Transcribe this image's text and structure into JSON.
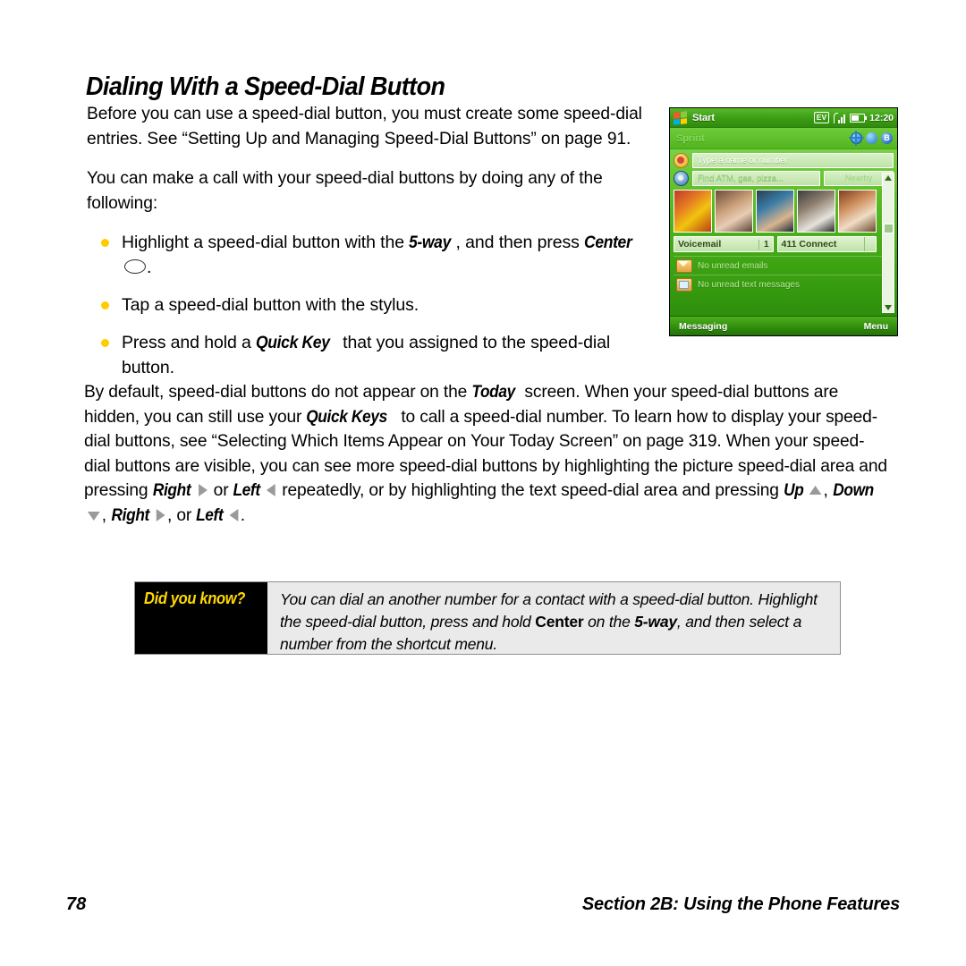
{
  "document": {
    "heading": "Dialing With a Speed-Dial Button",
    "paragraphs": {
      "intro1": "Before you can use a speed-dial button, you must create some speed-dial entries. See “Setting Up and Managing Speed-Dial Buttons” on page 91.",
      "intro2": "You can make a call with your speed-dial buttons by doing any of the following:"
    },
    "bullets": [
      {
        "pre": "Highlight a speed-dial button with the ",
        "em1": "5-way",
        "mid": ", and then press ",
        "em2": "Center",
        "glyph": "center-oval",
        "post": "."
      },
      {
        "pre": "Tap a speed-dial button with the stylus.",
        "em1": "",
        "mid": "",
        "em2": "",
        "glyph": "",
        "post": ""
      },
      {
        "pre": "Press and hold a ",
        "em1": "Quick Key",
        "mid": " that you assigned to the speed-dial button.",
        "em2": "",
        "glyph": "",
        "post": ""
      }
    ],
    "body_paragraph": {
      "s1": "By default, speed-dial buttons do not appear on the ",
      "em_today": "Today",
      "s2": " screen. When your speed-dial buttons are hidden, you can still use your ",
      "em_quickkeys": "Quick Keys",
      "s3": " to call a speed-dial number. To learn how to display your speed-dial buttons, see “Selecting Which Items Appear on Your Today Screen” on page 319. When your speed-dial buttons are visible, you can see more speed-dial buttons by highlighting the picture speed-dial area and pressing ",
      "em_right1": "Right",
      "s4": " or ",
      "em_left1": "Left",
      "s5": " repeatedly, or by highlighting the text speed-dial area and pressing ",
      "em_up": "Up",
      "s6": ", ",
      "em_down": "Down",
      "s7": ", ",
      "em_right2": "Right",
      "s8": ", or ",
      "em_left2": "Left",
      "s9": "."
    },
    "callout": {
      "label": "Did you know?",
      "line1": "You can dial an another number for a contact with a speed-dial button.",
      "line2_a": "Highlight the speed-dial button, press and hold ",
      "line2_b": "Center",
      "line2_c": " on the ",
      "line2_d": "5-way",
      "line2_e": ", and",
      "line3": "then select a number from the shortcut menu."
    },
    "footer": {
      "page_number": "78",
      "section": "Section 2B: Using the Phone Features"
    },
    "colors": {
      "bullet": "#FFCC00",
      "callout_label_text": "#FFD800",
      "callout_label_bg": "#000000",
      "callout_body_bg": "#EAEAEA",
      "glyph_arrow": "#9A9A9A"
    }
  },
  "device_screenshot": {
    "status_bar": {
      "start_label": "Start",
      "network_badge": "EV",
      "clock": "12:20",
      "icons": [
        "windows-logo-icon",
        "signal-bars-icon",
        "battery-icon"
      ]
    },
    "carrier_bar": {
      "carrier": "Sprint",
      "icons": [
        "globe-icon",
        "voice-command-icon",
        "bluetooth-icon"
      ]
    },
    "rows": [
      {
        "icon": "contacts-icon",
        "input_placeholder": "Type a name or number"
      },
      {
        "icon": "search-icon",
        "input_placeholder": "Find ATM, gas, pizza...",
        "button_label": "Nearby"
      }
    ],
    "photo_speed_dials": [
      "contact-photo-1",
      "contact-photo-2",
      "contact-photo-3",
      "contact-photo-4",
      "contact-photo-5"
    ],
    "text_speed_dials": [
      {
        "label": "Voicemail",
        "count": "1"
      },
      {
        "label": "411 Connect",
        "count": ""
      }
    ],
    "messages": [
      {
        "icon": "email-icon",
        "text": "No unread emails"
      },
      {
        "icon": "sms-icon",
        "text": "No unread text messages"
      }
    ],
    "soft_keys": {
      "left": "Messaging",
      "right": "Menu"
    }
  }
}
